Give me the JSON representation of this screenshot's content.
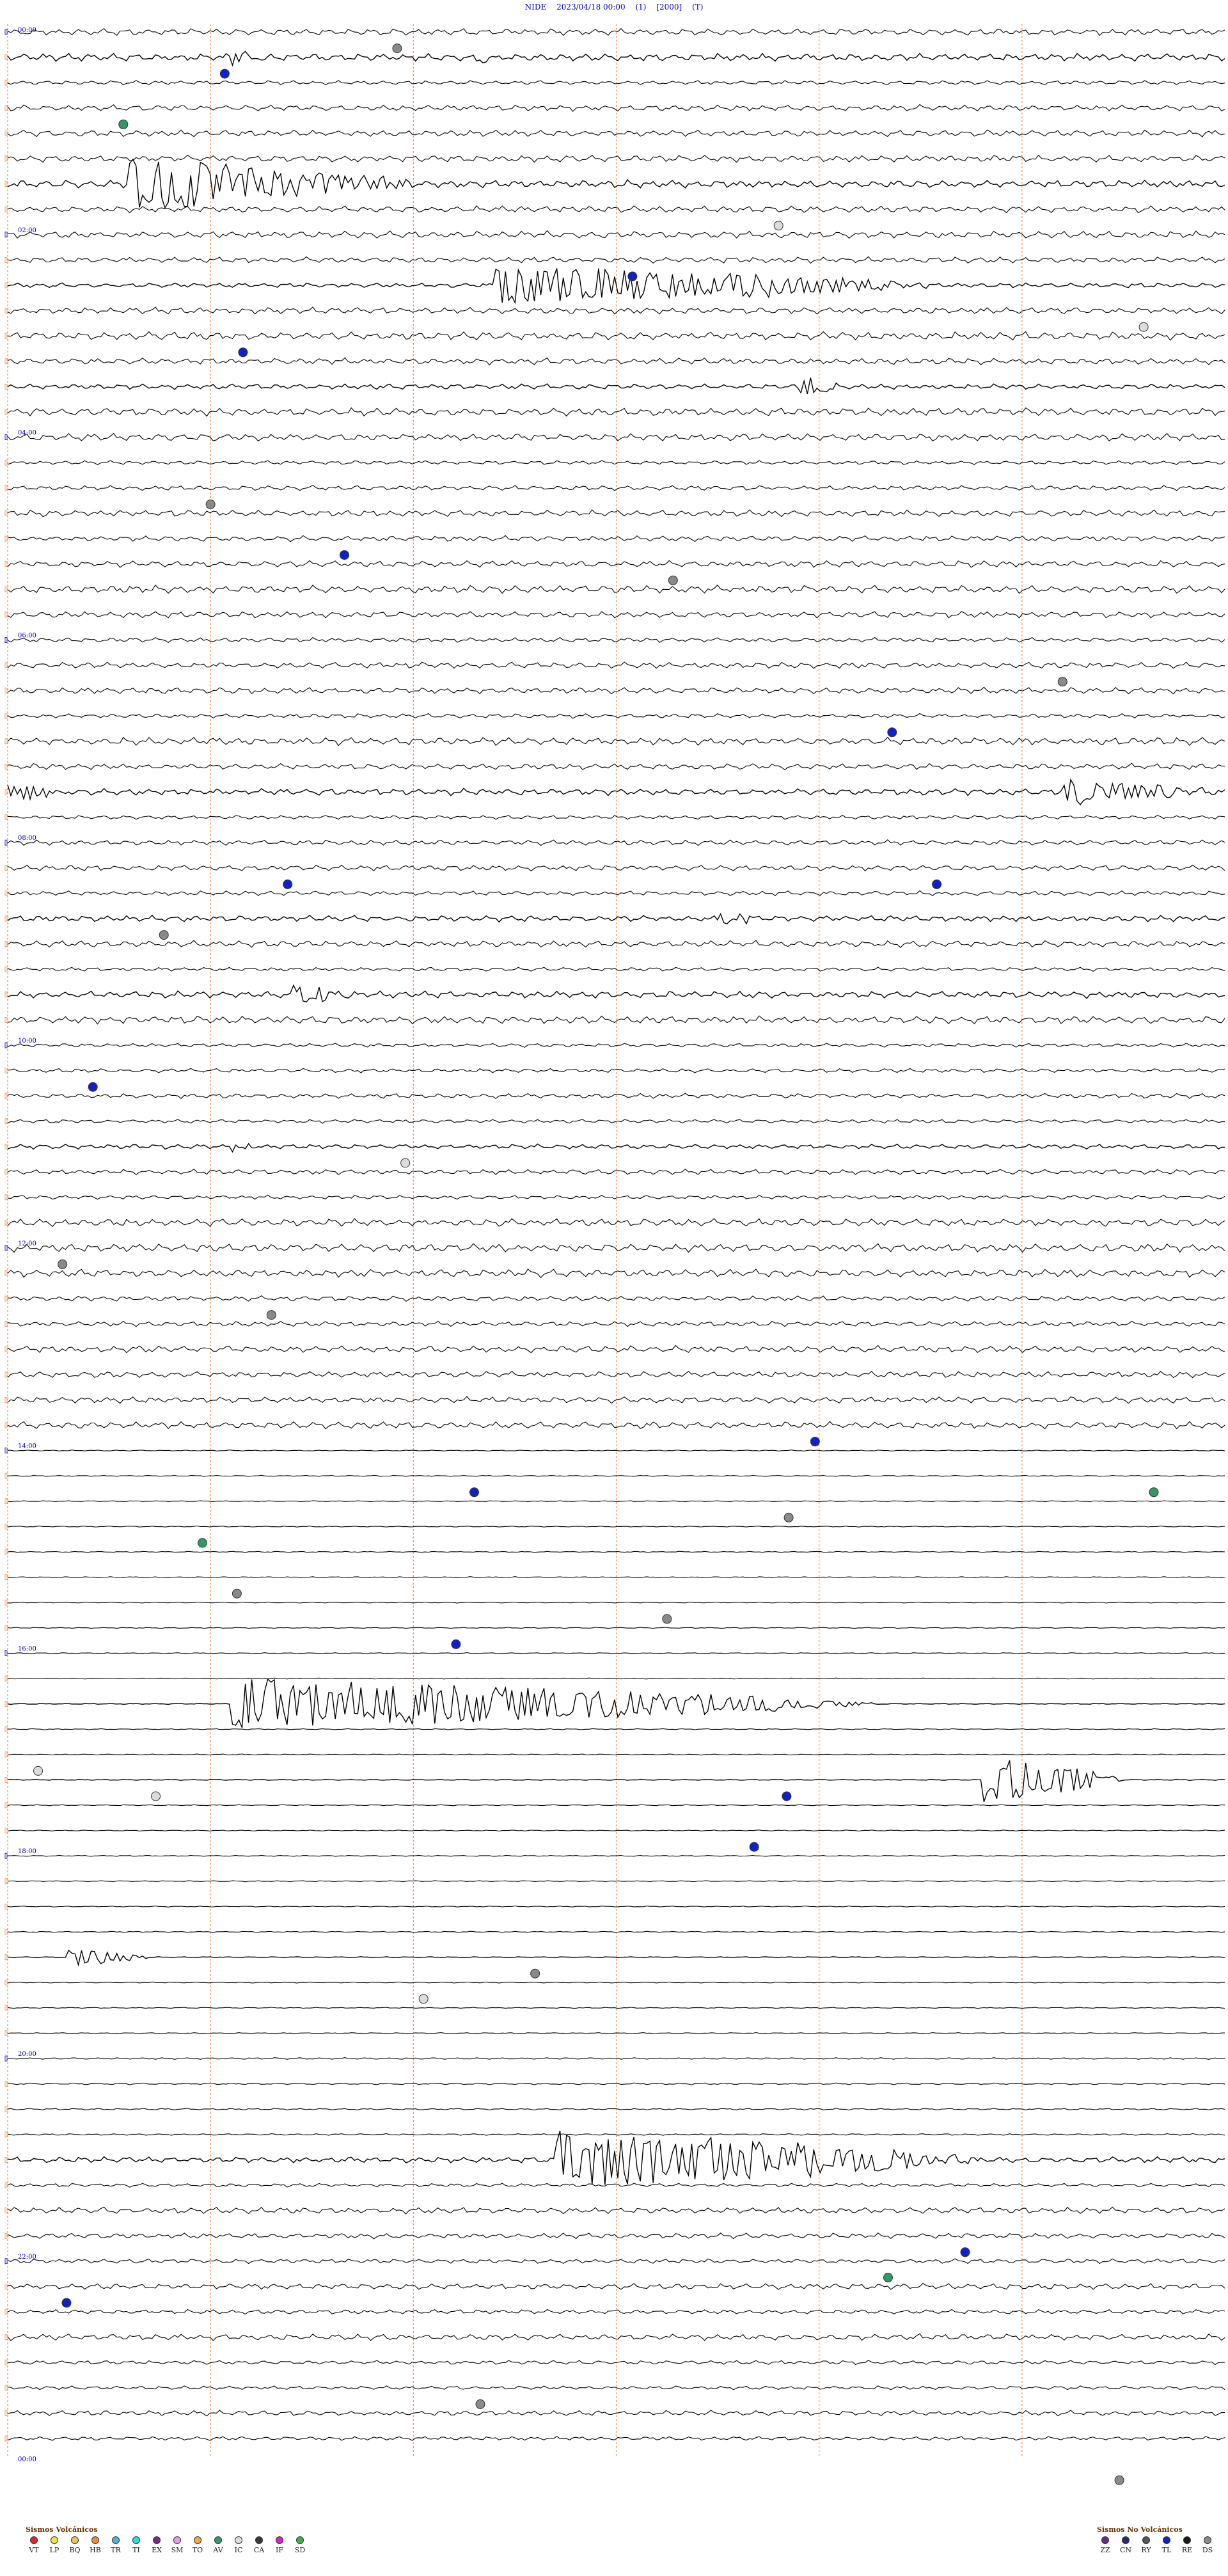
{
  "header": {
    "station": "NIDE",
    "datetime": "2023/04/18 00:00",
    "channel": "(1)",
    "scale": "[2000]",
    "flag": "(T)"
  },
  "colors": {
    "trace": "#000000",
    "minute_lines": "#ff8a3d",
    "hour_label": "#0000cc"
  },
  "chart_data": {
    "type": "helicorder",
    "hour_labels": [
      "00:00",
      "02:00",
      "04:00",
      "06:00",
      "08:00",
      "10:00",
      "12:00",
      "14:00",
      "16:00",
      "18:00",
      "20:00",
      "22:00",
      "00:00"
    ],
    "minute_markers": [
      0,
      10,
      20,
      30,
      40,
      50
    ],
    "events": [
      {
        "row": 1,
        "start_min": 11,
        "end_min": 13,
        "amp": 10
      },
      {
        "row": 1,
        "start_min": 23,
        "end_min": 24,
        "amp": 10
      },
      {
        "row": 6,
        "start_min": 6,
        "end_min": 20,
        "amp": 40
      },
      {
        "row": 10,
        "start_min": 24,
        "end_min": 46,
        "amp": 30
      },
      {
        "row": 14,
        "start_min": 39,
        "end_min": 41,
        "amp": 15
      },
      {
        "row": 30,
        "start_min": 52,
        "end_min": 60,
        "amp": 18
      },
      {
        "row": 30,
        "start_min": 0,
        "end_min": 3,
        "amp": 14
      },
      {
        "row": 35,
        "start_min": 35,
        "end_min": 37,
        "amp": 12
      },
      {
        "row": 38,
        "start_min": 14,
        "end_min": 17,
        "amp": 14
      },
      {
        "row": 44,
        "start_min": 11,
        "end_min": 12,
        "amp": 12
      },
      {
        "row": 66,
        "start_min": 11,
        "end_min": 43,
        "amp": 40
      },
      {
        "row": 69,
        "start_min": 48,
        "end_min": 55,
        "amp": 40
      },
      {
        "row": 76,
        "start_min": 3,
        "end_min": 7,
        "amp": 14
      },
      {
        "row": 84,
        "start_min": 27,
        "end_min": 48,
        "amp": 45
      }
    ],
    "markers": [
      {
        "row": 2,
        "min": 10.7,
        "type": "TL"
      },
      {
        "row": 1,
        "min": 19.2,
        "type": "DS"
      },
      {
        "row": 4,
        "min": 5.7,
        "type": "AV"
      },
      {
        "row": 8,
        "min": 38,
        "type": "IC"
      },
      {
        "row": 10,
        "min": 30.8,
        "type": "TL"
      },
      {
        "row": 13,
        "min": 11.6,
        "type": "TL"
      },
      {
        "row": 12,
        "min": 56,
        "type": "IC"
      },
      {
        "row": 19,
        "min": 10,
        "type": "DS"
      },
      {
        "row": 21,
        "min": 16.6,
        "type": "TL"
      },
      {
        "row": 22,
        "min": 32.8,
        "type": "DS"
      },
      {
        "row": 26,
        "min": 52,
        "type": "DS"
      },
      {
        "row": 28,
        "min": 43.6,
        "type": "TL"
      },
      {
        "row": 34,
        "min": 13.8,
        "type": "TL"
      },
      {
        "row": 34,
        "min": 45.8,
        "type": "TL"
      },
      {
        "row": 36,
        "min": 7.7,
        "type": "DS"
      },
      {
        "row": 42,
        "min": 4.2,
        "type": "TL"
      },
      {
        "row": 45,
        "min": 19.6,
        "type": "IC"
      },
      {
        "row": 49,
        "min": 2.7,
        "type": "DS"
      },
      {
        "row": 51,
        "min": 13,
        "type": "DS"
      },
      {
        "row": 56,
        "min": 39.8,
        "type": "TL"
      },
      {
        "row": 58,
        "min": 23,
        "type": "TL"
      },
      {
        "row": 59,
        "min": 38.5,
        "type": "DS"
      },
      {
        "row": 58,
        "min": 56.5,
        "type": "AV"
      },
      {
        "row": 60,
        "min": 9.6,
        "type": "AV"
      },
      {
        "row": 62,
        "min": 11.3,
        "type": "DS"
      },
      {
        "row": 63,
        "min": 32.5,
        "type": "DS"
      },
      {
        "row": 64,
        "min": 22.1,
        "type": "TL"
      },
      {
        "row": 69,
        "min": 1.5,
        "type": "IC"
      },
      {
        "row": 70,
        "min": 7.3,
        "type": "IC"
      },
      {
        "row": 70,
        "min": 38.4,
        "type": "TL"
      },
      {
        "row": 72,
        "min": 36.8,
        "type": "TL"
      },
      {
        "row": 77,
        "min": 26,
        "type": "DS"
      },
      {
        "row": 78,
        "min": 20.5,
        "type": "IC"
      },
      {
        "row": 88,
        "min": 47.2,
        "type": "TL"
      },
      {
        "row": 89,
        "min": 43.4,
        "type": "AV"
      },
      {
        "row": 90,
        "min": 2.9,
        "type": "TL"
      },
      {
        "row": 94,
        "min": 23.3,
        "type": "DS"
      },
      {
        "row": 97,
        "min": 54.8,
        "type": "DS"
      }
    ]
  },
  "legend_volcanic": {
    "title": "Sismos Volcánicos",
    "items": [
      {
        "label": "VT",
        "color": "#e8202a"
      },
      {
        "label": "LP",
        "color": "#f5e23a"
      },
      {
        "label": "BQ",
        "color": "#f0c05a"
      },
      {
        "label": "HB",
        "color": "#f08a30"
      },
      {
        "label": "TR",
        "color": "#4fb0e0"
      },
      {
        "label": "TI",
        "color": "#23e0e0"
      },
      {
        "label": "EX",
        "color": "#7a2a8a"
      },
      {
        "label": "SM",
        "color": "#e0a0e8"
      },
      {
        "label": "TO",
        "color": "#f4a640"
      },
      {
        "label": "AV",
        "color": "#2e9a6a"
      },
      {
        "label": "IC",
        "color": "#dcdcdc"
      },
      {
        "label": "CA",
        "color": "#3a3a3a"
      },
      {
        "label": "IF",
        "color": "#e020c8"
      },
      {
        "label": "SD",
        "color": "#40b040"
      }
    ]
  },
  "legend_nonvolcanic": {
    "title": "Sismos No Volcánicos",
    "items": [
      {
        "label": "ZZ",
        "color": "#6a2a8a"
      },
      {
        "label": "CN",
        "color": "#2a2a6a"
      },
      {
        "label": "RY",
        "color": "#555555"
      },
      {
        "label": "TL",
        "color": "#1020d0"
      },
      {
        "label": "RE",
        "color": "#1a1a1a"
      },
      {
        "label": "DS",
        "color": "#8a8a8a"
      }
    ]
  }
}
